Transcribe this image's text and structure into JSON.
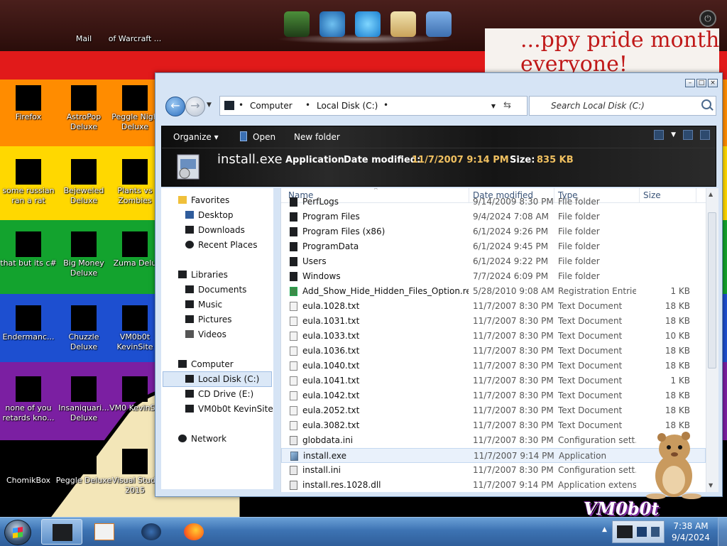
{
  "colors": {
    "wallpaper_stripes": [
      "#e11a1a",
      "#ff8c00",
      "#ffd800",
      "#13a32e",
      "#1d4fd0",
      "#7b1fa2"
    ],
    "accent_blue": "#2b6fc0",
    "detail_highlight": "#f0c060"
  },
  "wallpaper": {
    "note_line1": "...ppy pride month",
    "note_line2": "everyone!",
    "logo_text": "VM0b0t"
  },
  "top_dock": {
    "items": [
      "minecraft-icon",
      "windows-update-icon",
      "internet-explorer-icon",
      "mail-flag-icon",
      "messenger-icon"
    ]
  },
  "desktop_icons": [
    {
      "label": "Mail",
      "col": 1,
      "row": 0
    },
    {
      "label": "of Warcraft ...",
      "col": 2,
      "row": 0
    },
    {
      "label": "Firefox",
      "col": 0,
      "row": 1
    },
    {
      "label": "AstroPop Deluxe",
      "col": 1,
      "row": 1
    },
    {
      "label": "Peggle Nigh Deluxe",
      "col": 2,
      "row": 1
    },
    {
      "label": "some russian ran a rat",
      "col": 0,
      "row": 2
    },
    {
      "label": "Bejeweled Deluxe",
      "col": 1,
      "row": 2
    },
    {
      "label": "Plants vs Zombies",
      "col": 2,
      "row": 2
    },
    {
      "label": "that but its c#",
      "col": 0,
      "row": 3
    },
    {
      "label": "Big Money Deluxe",
      "col": 1,
      "row": 3
    },
    {
      "label": "Zuma Delu",
      "col": 2,
      "row": 3
    },
    {
      "label": "Endermanc...",
      "col": 0,
      "row": 4
    },
    {
      "label": "Chuzzle Deluxe",
      "col": 1,
      "row": 4
    },
    {
      "label": "VM0b0t KevinSite",
      "col": 2,
      "row": 4
    },
    {
      "label": "none of you retards kno...",
      "col": 0,
      "row": 5
    },
    {
      "label": "Insaniquari... Deluxe",
      "col": 1,
      "row": 5
    },
    {
      "label": "VM0 KevinSit",
      "col": 2,
      "row": 5
    },
    {
      "label": "ChomikBox",
      "col": 0,
      "row": 6
    },
    {
      "label": "Peggle Deluxe",
      "col": 1,
      "row": 6
    },
    {
      "label": "Visual Studi 2015",
      "col": 2,
      "row": 6
    }
  ],
  "explorer": {
    "address": {
      "crumb1": "Computer",
      "crumb2": "Local Disk (C:)",
      "sep": "•"
    },
    "search_placeholder": "Search Local Disk (C:)",
    "toolbar": {
      "organize": "Organize",
      "open": "Open",
      "new_folder": "New folder"
    },
    "details": {
      "name": "install.exe",
      "type": "Application",
      "date_label": "Date modified:",
      "date_value": "11/7/2007 9:14 PM",
      "size_label": "Size:",
      "size_value": "835 KB"
    },
    "nav": {
      "favorites": "Favorites",
      "desktop": "Desktop",
      "downloads": "Downloads",
      "recent": "Recent Places",
      "libraries": "Libraries",
      "documents": "Documents",
      "music": "Music",
      "pictures": "Pictures",
      "videos": "Videos",
      "computer": "Computer",
      "local_disk": "Local Disk (C:)",
      "cd_drive": "CD Drive (E:)",
      "vm": "VM0b0t KevinSite",
      "network": "Network"
    },
    "columns": {
      "name": "Name",
      "date": "Date modified",
      "type": "Type",
      "size": "Size"
    },
    "rows": [
      {
        "name": "PerfLogs",
        "date": "9/14/2009 8:30 PM",
        "type": "File folder",
        "size": "",
        "icon": "folder"
      },
      {
        "name": "Program Files",
        "date": "9/4/2024 7:08 AM",
        "type": "File folder",
        "size": "",
        "icon": "folder"
      },
      {
        "name": "Program Files (x86)",
        "date": "6/1/2024 9:26 PM",
        "type": "File folder",
        "size": "",
        "icon": "folder"
      },
      {
        "name": "ProgramData",
        "date": "6/1/2024 9:45 PM",
        "type": "File folder",
        "size": "",
        "icon": "folder"
      },
      {
        "name": "Users",
        "date": "6/1/2024 9:22 PM",
        "type": "File folder",
        "size": "",
        "icon": "folder"
      },
      {
        "name": "Windows",
        "date": "7/7/2024 6:09 PM",
        "type": "File folder",
        "size": "",
        "icon": "folder"
      },
      {
        "name": "Add_Show_Hide_Hidden_Files_Option.reg",
        "date": "5/28/2010 9:08 AM",
        "type": "Registration Entries",
        "size": "1 KB",
        "icon": "reg"
      },
      {
        "name": "eula.1028.txt",
        "date": "11/7/2007 8:30 PM",
        "type": "Text Document",
        "size": "18 KB",
        "icon": "doc"
      },
      {
        "name": "eula.1031.txt",
        "date": "11/7/2007 8:30 PM",
        "type": "Text Document",
        "size": "18 KB",
        "icon": "doc"
      },
      {
        "name": "eula.1033.txt",
        "date": "11/7/2007 8:30 PM",
        "type": "Text Document",
        "size": "10 KB",
        "icon": "doc"
      },
      {
        "name": "eula.1036.txt",
        "date": "11/7/2007 8:30 PM",
        "type": "Text Document",
        "size": "18 KB",
        "icon": "doc"
      },
      {
        "name": "eula.1040.txt",
        "date": "11/7/2007 8:30 PM",
        "type": "Text Document",
        "size": "18 KB",
        "icon": "doc"
      },
      {
        "name": "eula.1041.txt",
        "date": "11/7/2007 8:30 PM",
        "type": "Text Document",
        "size": "1 KB",
        "icon": "doc"
      },
      {
        "name": "eula.1042.txt",
        "date": "11/7/2007 8:30 PM",
        "type": "Text Document",
        "size": "18 KB",
        "icon": "doc"
      },
      {
        "name": "eula.2052.txt",
        "date": "11/7/2007 8:30 PM",
        "type": "Text Document",
        "size": "18 KB",
        "icon": "doc"
      },
      {
        "name": "eula.3082.txt",
        "date": "11/7/2007 8:30 PM",
        "type": "Text Document",
        "size": "18 KB",
        "icon": "doc"
      },
      {
        "name": "globdata.ini",
        "date": "11/7/2007 8:30 PM",
        "type": "Configuration sett...",
        "size": "",
        "icon": "ini"
      },
      {
        "name": "install.exe",
        "date": "11/7/2007 9:14 PM",
        "type": "Application",
        "size": "",
        "icon": "exe",
        "selected": true
      },
      {
        "name": "install.ini",
        "date": "11/7/2007 8:30 PM",
        "type": "Configuration sett...",
        "size": "",
        "icon": "ini"
      },
      {
        "name": "install.res.1028.dll",
        "date": "11/7/2007 9:14 PM",
        "type": "Application extens...",
        "size": "",
        "icon": "ini"
      }
    ]
  },
  "taskbar": {
    "pinned": [
      "explorer-window-icon",
      "media-player-icon",
      "globe-icon",
      "firefox-icon"
    ],
    "clock_time": "7:38 AM",
    "clock_date": "9/4/2024"
  }
}
